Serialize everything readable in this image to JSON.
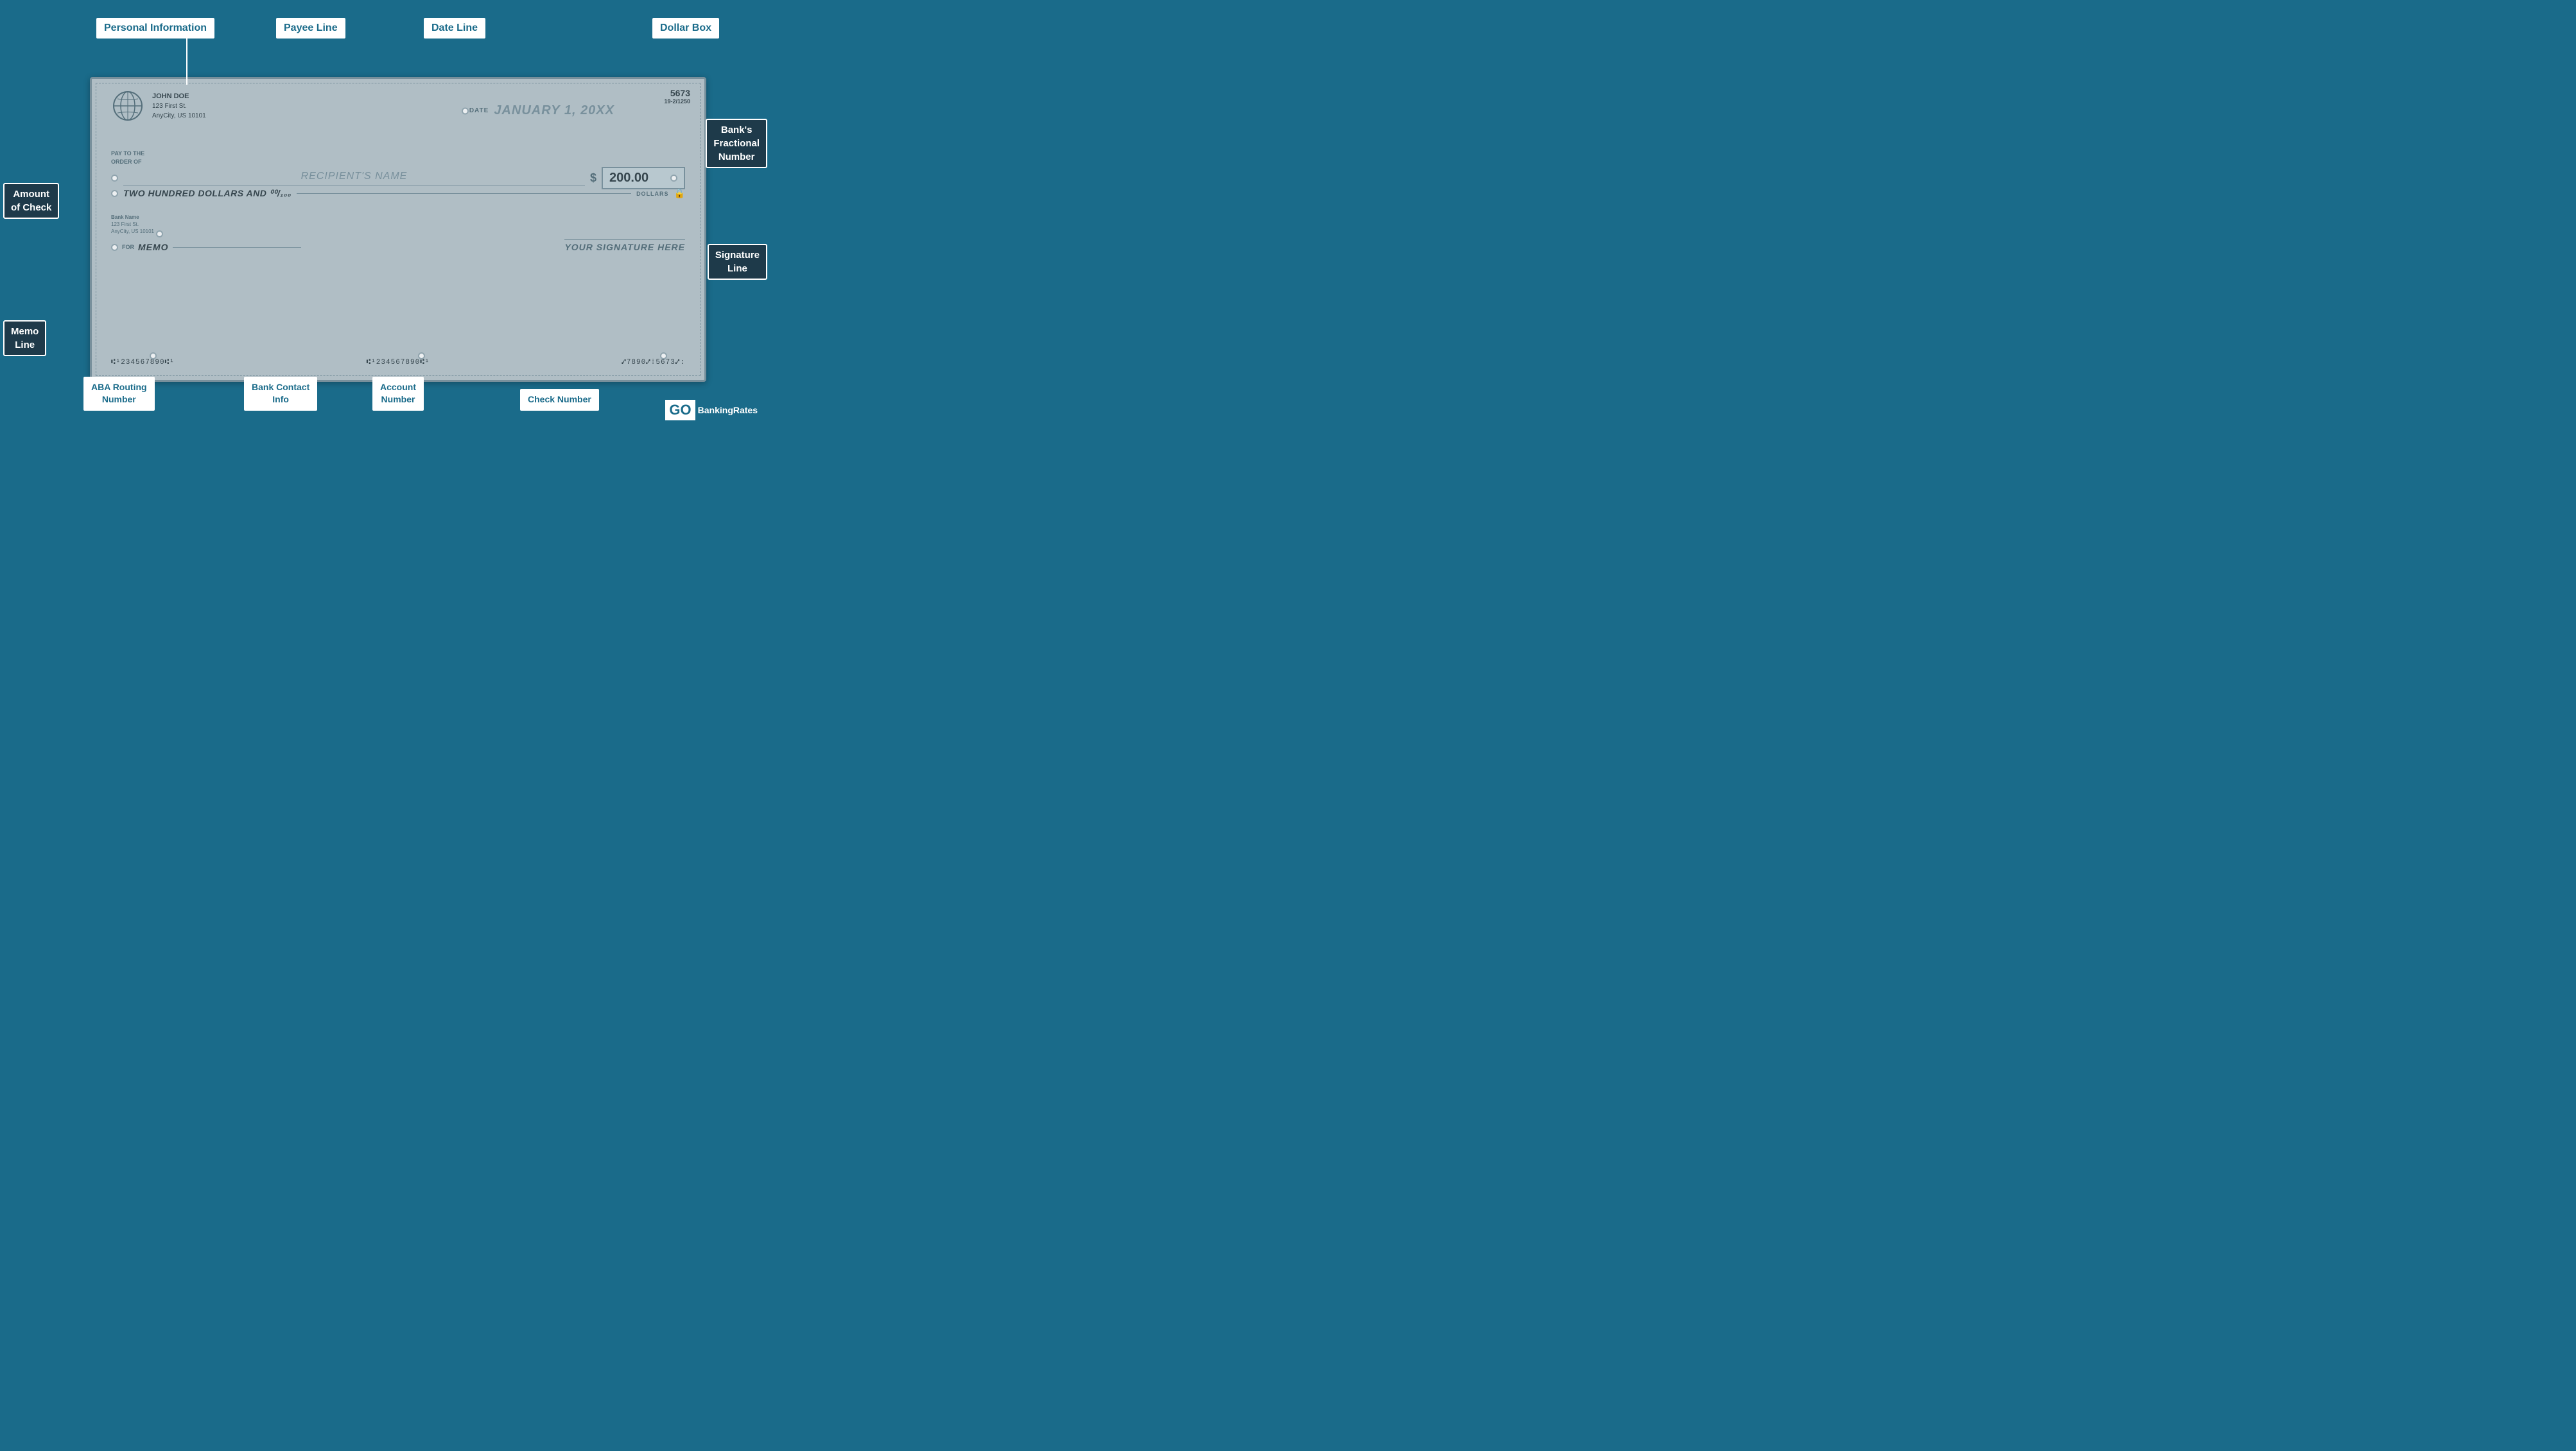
{
  "labels": {
    "personal_information": "Personal Information",
    "payee_line": "Payee Line",
    "date_line": "Date Line",
    "dollar_box": "Dollar Box",
    "banks_fractional_number": "Bank's\nFractional\nNumber",
    "amount_of_check": "Amount\nof Check",
    "signature_line": "Signature\nLine",
    "memo_line": "Memo\nLine",
    "aba_routing_number": "ABA Routing\nNumber",
    "bank_contact_info": "Bank Contact\nInfo",
    "account_number": "Account\nNumber",
    "check_number": "Check Number"
  },
  "check": {
    "number": "5673",
    "fractional": "19-2/1250",
    "owner_name": "JOHN DOE",
    "owner_address1": "123 First St.",
    "owner_city": "AnyCity, US 10101",
    "date_label": "DATE",
    "date_value": "JANUARY 1, 20XX",
    "pay_to_label": "PAY TO THE\nORDER OF",
    "recipient_name": "RECIPIENT'S NAME",
    "dollar_sign": "$",
    "amount": "200.00",
    "written_amount": "TWO HUNDRED DOLLARS AND ⁰⁰/₁₀₀",
    "dollars_label": "DOLLARS",
    "bank_name": "Bank Name",
    "bank_address1": "123 First St.",
    "bank_city": "AnyCity, US 10101",
    "for_label": "FOR",
    "memo_text": "MEMO",
    "signature_text": "YOUR SIGNATURE HERE",
    "micr_routing": "Ⅱ¹1234567890Ⅱ¹",
    "micr_account": "Ⅱ¹1234567890Ⅱ¹",
    "micr_check": "Ⅱ:7890Ⅱ‴5673Ⅱ:"
  },
  "logo": {
    "go_text": "GO",
    "banking_rates": "BankingRates"
  },
  "colors": {
    "background": "#1a6b8a",
    "check_bg": "#b0bec5",
    "text_dark": "#37474f",
    "text_mid": "#546e7a",
    "text_light": "#78909c"
  }
}
